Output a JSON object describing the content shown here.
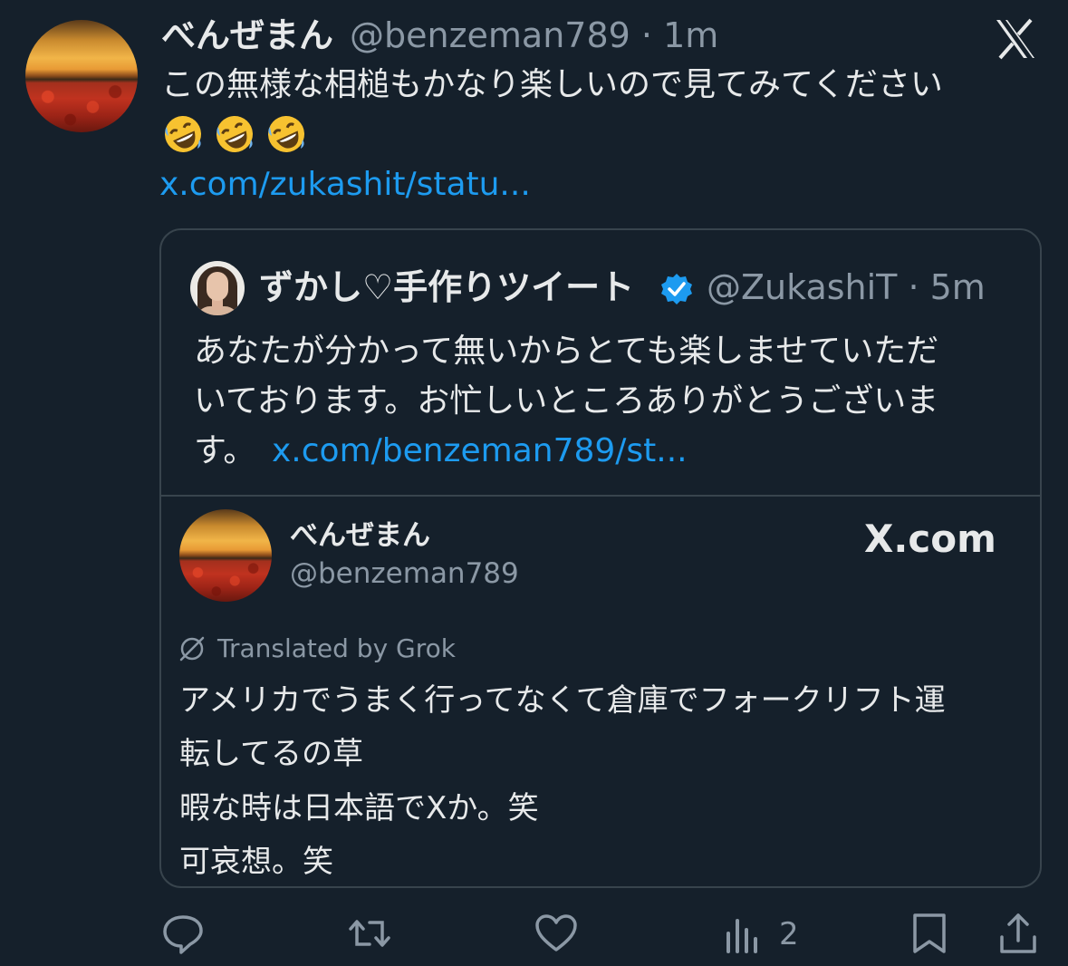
{
  "post": {
    "display_name": "べんぜまん",
    "meta": "@benzeman789 · 1m",
    "text_line1": "この無様な相槌もかなり楽しいので見てみてください",
    "emojis": [
      "rolling-on-floor-laughing",
      "rolling-on-floor-laughing",
      "rolling-on-floor-laughing"
    ],
    "link": "x.com/zukashit/statu..."
  },
  "quote": {
    "display_name": "ずかし♡手作りツイート",
    "meta": "@ZukashiT · 5m",
    "text_lines": [
      "あなたが分かって無いからとても楽しませていただ",
      "いております。お忙しいところありがとうございま",
      "す。"
    ],
    "link": "x.com/benzeman789/st..."
  },
  "link_card": {
    "display_name": "べんぜまん",
    "handle": "@benzeman789",
    "domain": "X.com",
    "translated_label": "Translated by Grok",
    "translated_lines": [
      "アメリカでうまく行ってなくて倉庫でフォークリフト運",
      "転してるの草",
      "暇な時は日本語でXか。笑",
      "可哀想。笑"
    ]
  },
  "actions": {
    "views_count": "2"
  },
  "colors": {
    "background": "#15202b",
    "text": "#e7e9ea",
    "secondary": "#8b98a5",
    "link": "#1d9bf0",
    "border": "#38444d"
  }
}
